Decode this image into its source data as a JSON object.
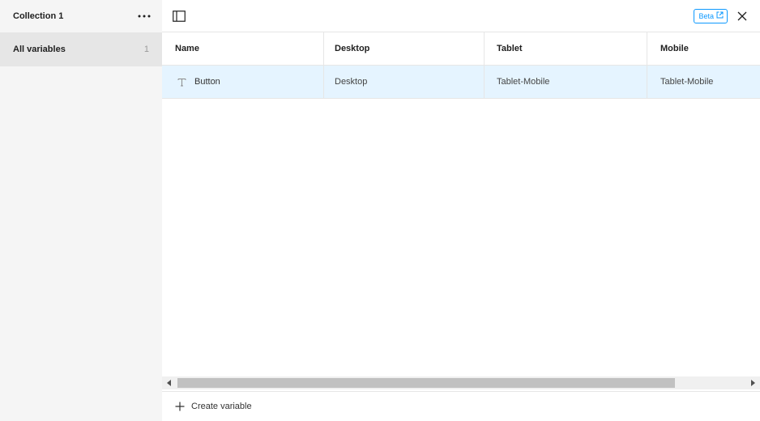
{
  "sidebar": {
    "collection_title": "Collection 1",
    "more_icon": "ellipsis-icon",
    "items": [
      {
        "label": "All variables",
        "count": "1"
      }
    ]
  },
  "topbar": {
    "panel_toggle_icon": "sidebar-toggle-icon",
    "beta_label": "Beta",
    "beta_icon": "external-link-icon",
    "close_icon": "close-icon"
  },
  "table": {
    "columns": [
      "Name",
      "Desktop",
      "Tablet",
      "Mobile"
    ],
    "rows": [
      {
        "type_icon": "text-type-icon",
        "name": "Button",
        "values": [
          "Desktop",
          "Tablet-Mobile",
          "Tablet-Mobile"
        ]
      }
    ]
  },
  "scrollbar": {
    "left_icon": "arrow-left-icon",
    "right_icon": "arrow-right-icon",
    "position": 0
  },
  "footer": {
    "plus_icon": "plus-icon",
    "create_label": "Create variable"
  },
  "colors": {
    "accent": "#0d99ff",
    "selected_row": "#e5f4ff",
    "sidebar_bg": "#f5f5f5",
    "sidebar_selected": "#e6e6e6"
  }
}
